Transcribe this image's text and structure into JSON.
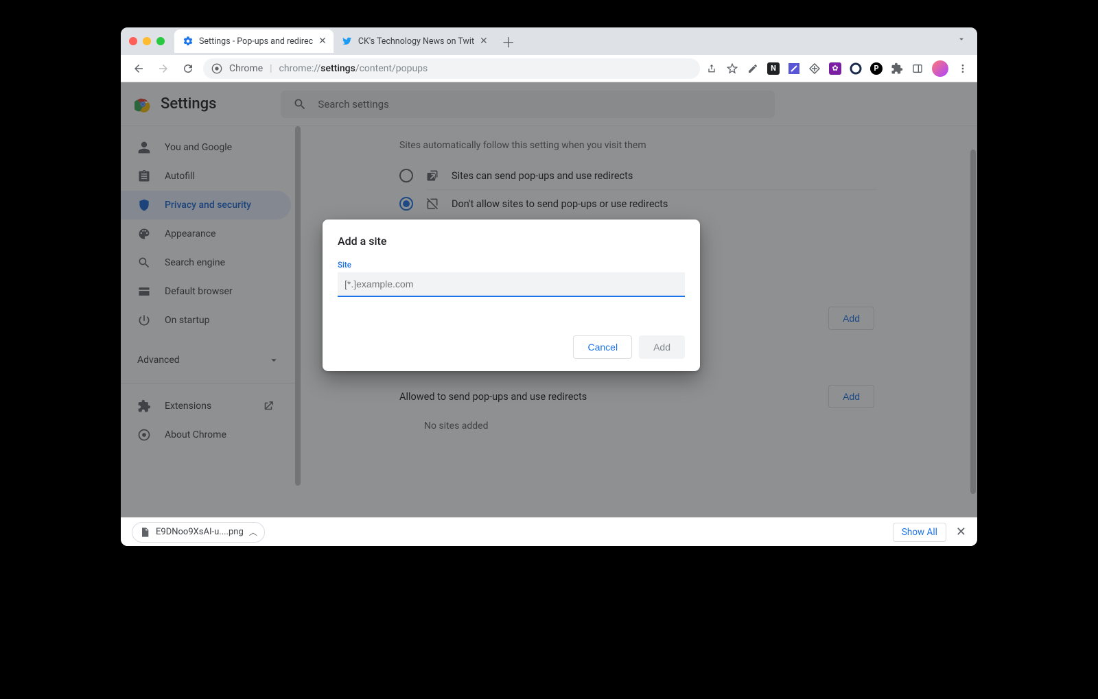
{
  "tabs": [
    {
      "title": "Settings - Pop-ups and redirec",
      "active": true,
      "favicon": "gear"
    },
    {
      "title": "CK's Technology News on Twit",
      "active": false,
      "favicon": "twitter"
    }
  ],
  "omnibox": {
    "scheme_chip": "Chrome",
    "url_prefix": "chrome://",
    "url_bold": "settings",
    "url_rest": "/content/popups"
  },
  "settings": {
    "app_title": "Settings",
    "search_placeholder": "Search settings",
    "sidebar": {
      "items": [
        {
          "icon": "person",
          "label": "You and Google"
        },
        {
          "icon": "clipboard",
          "label": "Autofill"
        },
        {
          "icon": "shield",
          "label": "Privacy and security",
          "active": true
        },
        {
          "icon": "palette",
          "label": "Appearance"
        },
        {
          "icon": "search",
          "label": "Search engine"
        },
        {
          "icon": "browser",
          "label": "Default browser"
        },
        {
          "icon": "power",
          "label": "On startup"
        }
      ],
      "advanced_label": "Advanced",
      "extensions_label": "Extensions",
      "about_label": "About Chrome"
    },
    "main": {
      "default_behavior_subhead": "Sites automatically follow this setting when you visit them",
      "option_allow": "Sites can send pop-ups and use redirects",
      "option_block": "Don't allow sites to send pop-ups or use redirects",
      "allowed_heading": "Allowed to send pop-ups and use redirects",
      "add_button": "Add",
      "no_sites": "No sites added"
    }
  },
  "dialog": {
    "title": "Add a site",
    "field_label": "Site",
    "placeholder": "[*.]example.com",
    "cancel": "Cancel",
    "confirm": "Add"
  },
  "downloads": {
    "item": "E9DNoo9XsAI-u....png",
    "show_all": "Show All"
  }
}
